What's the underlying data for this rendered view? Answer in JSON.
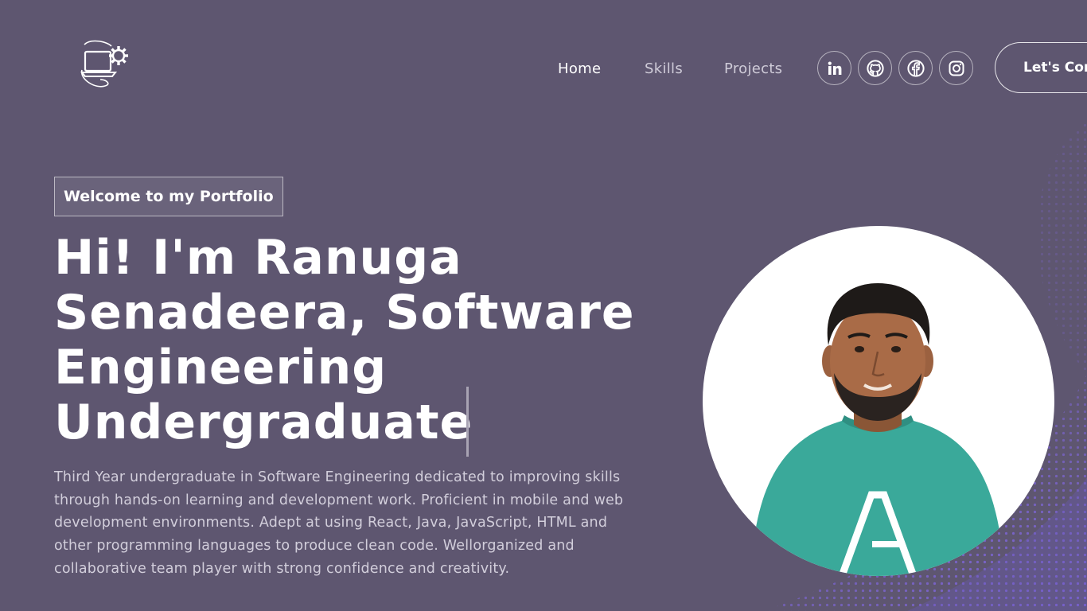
{
  "nav": {
    "links": [
      "Home",
      "Skills",
      "Projects"
    ],
    "active": "Home",
    "socials": [
      "linkedin-icon",
      "github-icon",
      "facebook-icon",
      "instagram-icon"
    ],
    "cta_label": "Let's Connect"
  },
  "hero": {
    "tagline": "Welcome to my Portfolio",
    "headline_lines": [
      "Hi! I'm Ranuga",
      "Senadeera, Software",
      "Engineering",
      "Undergraduate"
    ],
    "description": "Third Year undergraduate in Software Engineering dedicated to improving skills through hands-on learning and development work. Proficient in mobile and web development environments. Adept at using React, Java, JavaScript, HTML and other programming languages to produce clean code. Wellorganized and collaborative team player with strong confidence and creativity."
  },
  "colors": {
    "background": "#5e5670",
    "accent_dots": "#7a5fd6",
    "shirt": "#3aa99a"
  }
}
